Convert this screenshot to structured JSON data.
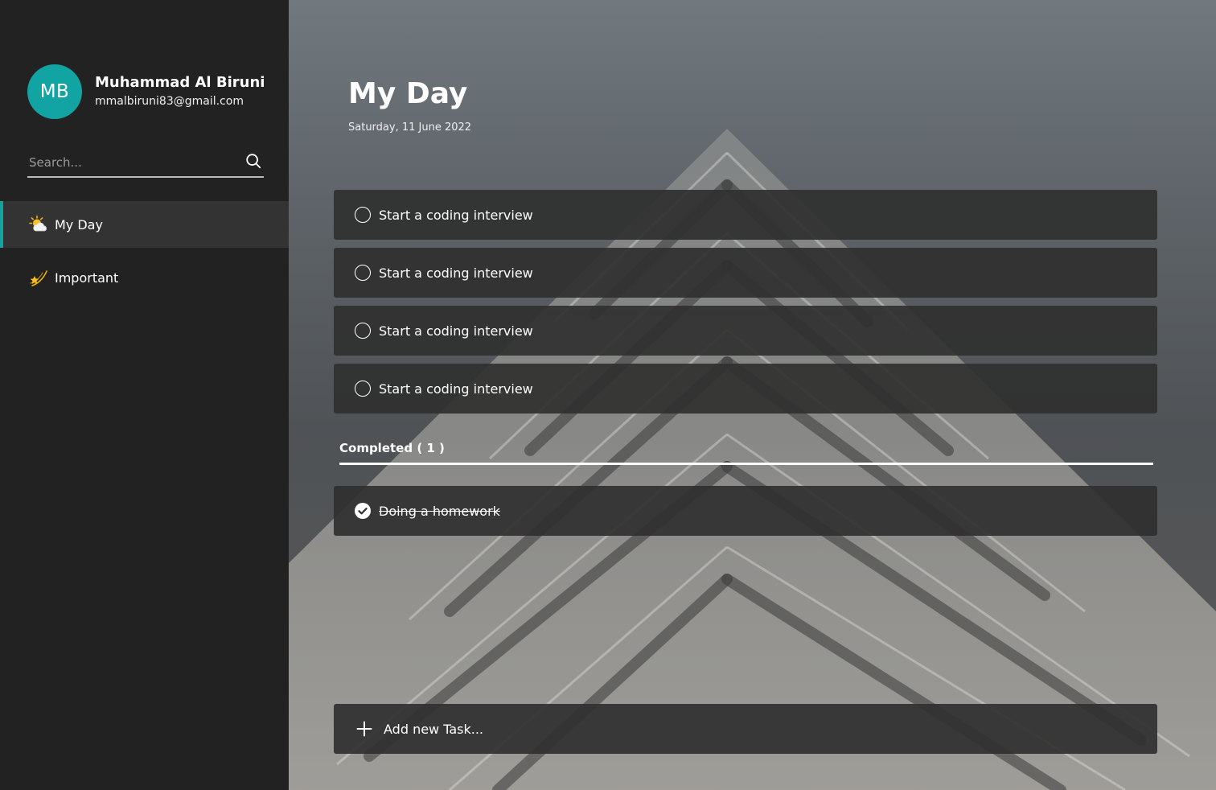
{
  "user": {
    "initials": "MB",
    "name": "Muhammad Al Biruni",
    "email": "mmalbiruni83@gmail.com"
  },
  "search": {
    "placeholder": "Search..."
  },
  "nav": {
    "items": [
      {
        "label": "My Day",
        "icon": "sun-behind-cloud-icon",
        "active": true
      },
      {
        "label": "Important",
        "icon": "shooting-star-icon",
        "active": false
      }
    ]
  },
  "page": {
    "title": "My Day",
    "date": "Saturday, 11 June 2022"
  },
  "tasks": [
    {
      "text": "Start a coding interview",
      "done": false
    },
    {
      "text": "Start a coding interview",
      "done": false
    },
    {
      "text": "Start a coding interview",
      "done": false
    },
    {
      "text": "Start a coding interview",
      "done": false
    }
  ],
  "completed": {
    "label": "Completed",
    "count": "( 1 )",
    "tasks": [
      {
        "text": "Doing a homework",
        "done": true
      }
    ]
  },
  "add_task": {
    "placeholder": "Add new Task..."
  },
  "colors": {
    "accent": "#12a3a3",
    "sidebar": "#222222",
    "active_item": "#333333",
    "task_bg": "#303030"
  }
}
